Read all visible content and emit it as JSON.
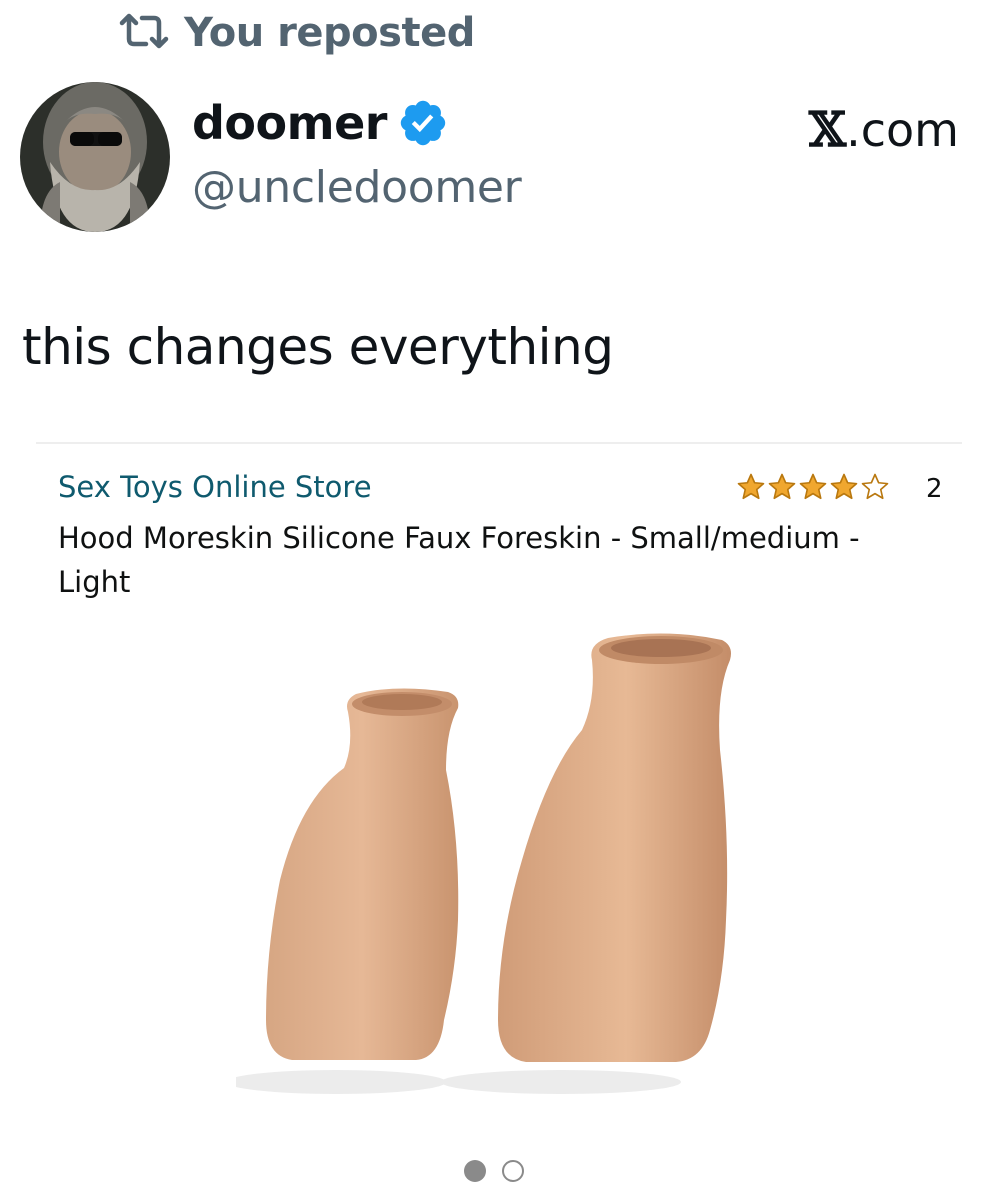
{
  "repost": {
    "label": "You reposted",
    "icon": "repost-icon"
  },
  "author": {
    "display_name": "doomer",
    "handle": "@uncledoomer",
    "verified_icon": "verified-badge-icon",
    "verified_color": "#1d9bf0",
    "avatar_icon": "avatar-bearded-man-sunglasses"
  },
  "brand": {
    "x_glyph": "𝕏",
    "domain": ".com"
  },
  "tweet": {
    "text": "this changes everything"
  },
  "product_card": {
    "store_name": "Sex Toys Online Store",
    "rating_stars": 4,
    "rating_max": 5,
    "rating_count": "2",
    "title": "Hood Moreskin Silicone Faux Foreskin - Small/medium - Light",
    "star_color": "#f0a72f",
    "store_color": "#0f5a6e",
    "carousel": {
      "total": 2,
      "active": 1
    }
  }
}
